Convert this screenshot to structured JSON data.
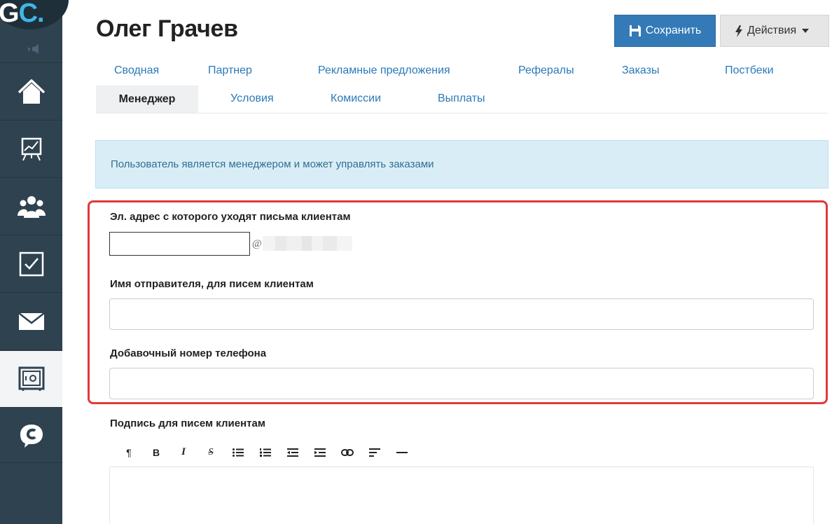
{
  "sidebar": {
    "logo": {
      "letter1": "G",
      "letter2": "C"
    },
    "items": [
      {
        "name": "home",
        "icon": "home-icon"
      },
      {
        "name": "stats",
        "icon": "chart-icon"
      },
      {
        "name": "users",
        "icon": "users-icon"
      },
      {
        "name": "tasks",
        "icon": "checkbox-icon"
      },
      {
        "name": "mail",
        "icon": "envelope-icon"
      },
      {
        "name": "safe",
        "icon": "safe-icon",
        "active": true
      },
      {
        "name": "chat",
        "icon": "chat-bubble-icon"
      }
    ]
  },
  "header": {
    "title": "Олег Грачев",
    "save_label": "Сохранить",
    "actions_label": "Действия"
  },
  "tabs": [
    {
      "label": "Сводная"
    },
    {
      "label": "Партнер"
    },
    {
      "label": "Рекламные предложения"
    },
    {
      "label": "Рефералы"
    },
    {
      "label": "Заказы"
    },
    {
      "label": "Постбеки"
    },
    {
      "label": "Менеджер",
      "active": true
    },
    {
      "label": "Условия"
    },
    {
      "label": "Комиссии"
    },
    {
      "label": "Выплаты"
    }
  ],
  "alert": {
    "text": "Пользователь является менеджером и может управлять заказами"
  },
  "form": {
    "email_label": "Эл. адрес с которого уходят письма клиентам",
    "email_value": "",
    "at_sign": "@",
    "sender_label": "Имя отправителя, для писем клиентам",
    "sender_value": "",
    "phone_label": "Добавочный номер телефона",
    "phone_value": "",
    "signature_label": "Подпись для писем клиентам"
  },
  "editor": {
    "tools": [
      {
        "name": "paragraph",
        "glyph": "¶"
      },
      {
        "name": "bold",
        "glyph": "B"
      },
      {
        "name": "italic",
        "glyph": "I"
      },
      {
        "name": "strikethrough",
        "glyph": "S"
      },
      {
        "name": "unordered-list",
        "glyph": ""
      },
      {
        "name": "ordered-list",
        "glyph": ""
      },
      {
        "name": "outdent",
        "glyph": ""
      },
      {
        "name": "indent",
        "glyph": ""
      },
      {
        "name": "link",
        "glyph": ""
      },
      {
        "name": "align",
        "glyph": ""
      },
      {
        "name": "horizontal-rule",
        "glyph": ""
      }
    ]
  },
  "colors": {
    "sidebar_bg": "#2f4250",
    "accent": "#337ab7",
    "link": "#2a7ab8",
    "highlight": "#e03a3a",
    "alert_bg": "#d9edf7",
    "alert_text": "#31708f"
  }
}
